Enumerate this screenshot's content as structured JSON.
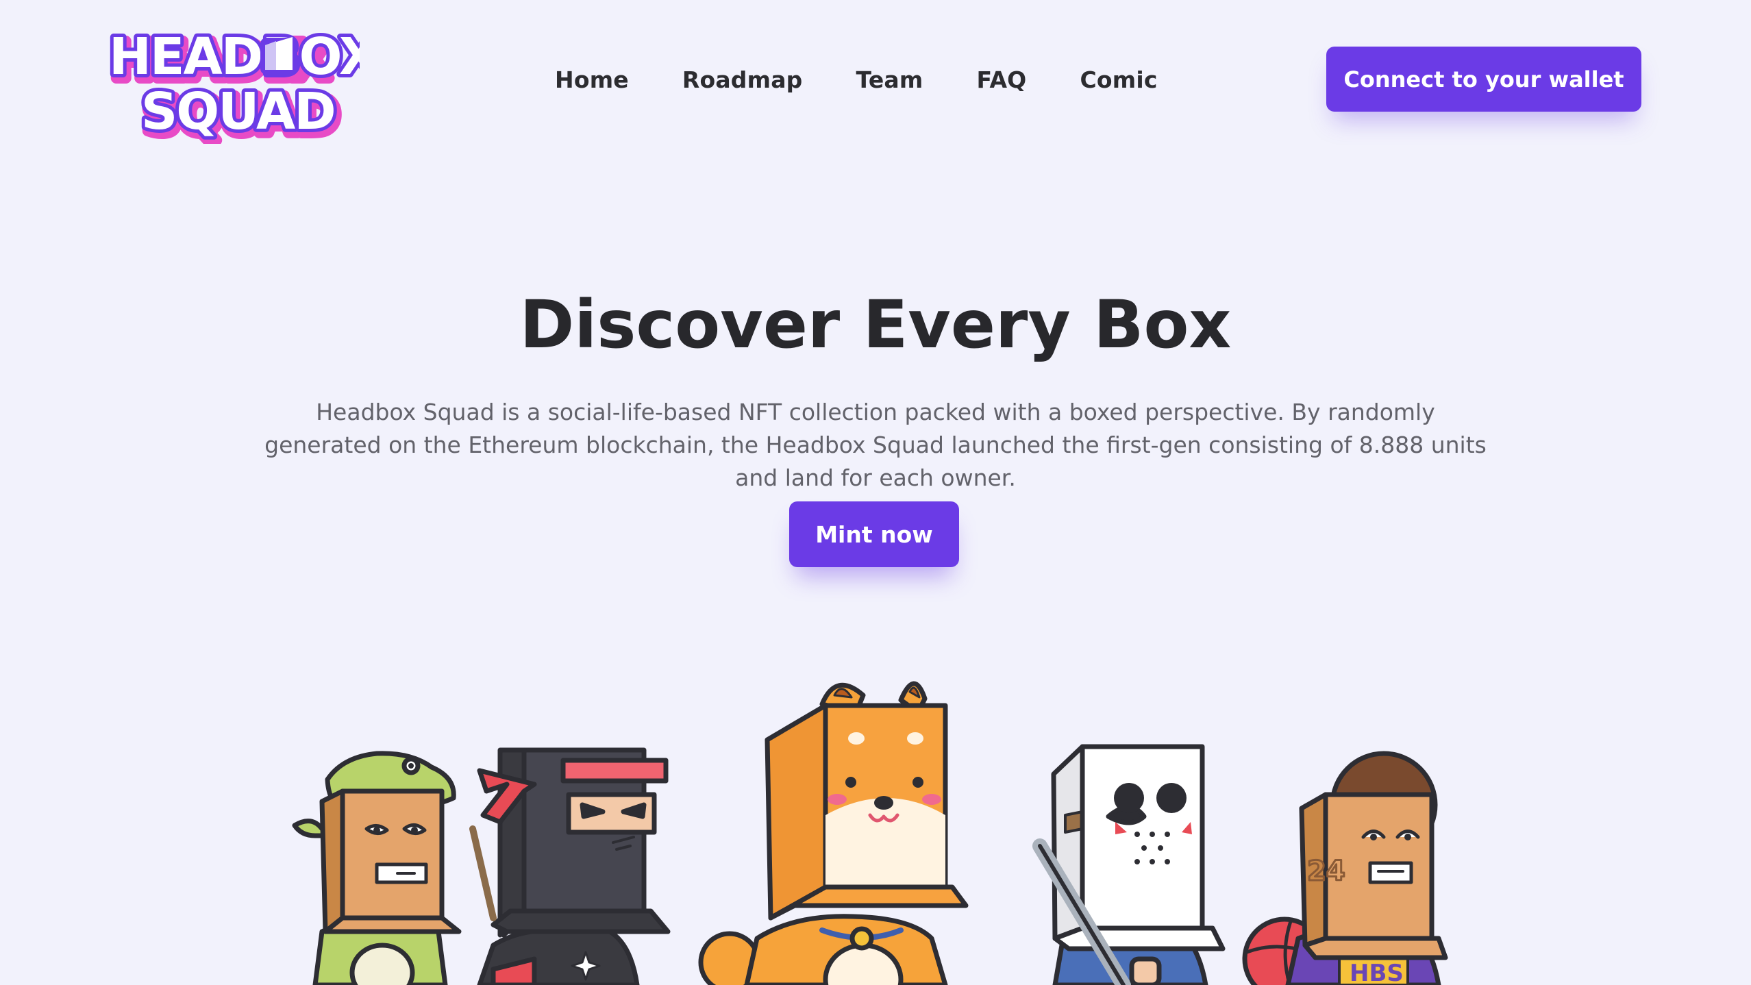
{
  "logo": {
    "line1": "HEADBOX",
    "line2": "SQUAD"
  },
  "nav": [
    {
      "label": "Home"
    },
    {
      "label": "Roadmap"
    },
    {
      "label": "Team"
    },
    {
      "label": "FAQ"
    },
    {
      "label": "Comic"
    }
  ],
  "wallet_button": {
    "label": "Connect to your wallet"
  },
  "hero": {
    "title": "Discover Every Box",
    "description": "Headbox Squad is a social-life-based NFT collection packed with a boxed perspective. By randomly generated on the Ethereum blockchain, the Headbox Squad launched the first-gen consisting of 8.888 units and land for each owner.",
    "mint_label": "Mint now"
  },
  "characters": {
    "jersey_number": "24",
    "jersey_text": "HBS"
  },
  "colors": {
    "background": "#f2f2fc",
    "accent": "#6b3be6",
    "logo_pink": "#e84bc6"
  }
}
